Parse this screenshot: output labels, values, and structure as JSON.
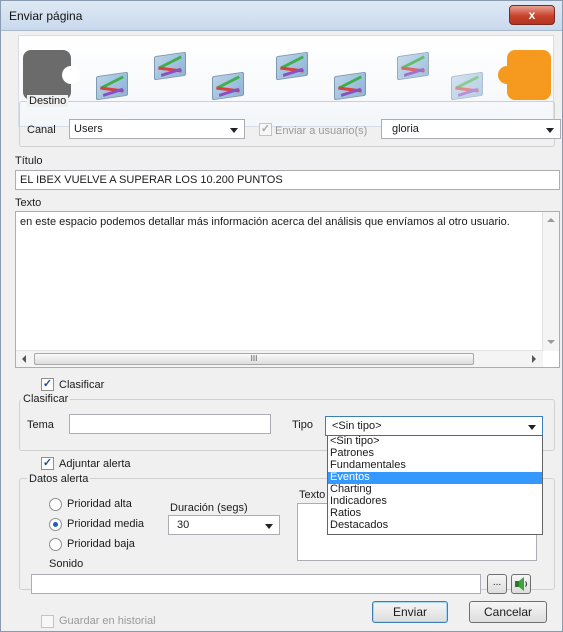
{
  "window": {
    "title": "Enviar página",
    "close_glyph": "x"
  },
  "banner": {
    "icons": [
      "puzzle-gray-icon",
      "chart-thumbnail-icon",
      "puzzle-orange-icon"
    ]
  },
  "destino": {
    "group_label": "Destino",
    "canal_label": "Canal",
    "canal_value": "Users",
    "send_to_user_label": "Enviar a usuario(s)",
    "send_to_user_checked": true,
    "user_value": "gloria"
  },
  "titulo": {
    "label": "Título",
    "value": "EL IBEX VUELVE A SUPERAR LOS 10.200 PUNTOS"
  },
  "texto": {
    "label": "Texto",
    "value": "en este espacio podemos detallar más información acerca del análisis que envíamos al otro usuario.",
    "hscroll_grip": "III"
  },
  "clasificar": {
    "checkbox_label": "Clasificar",
    "checked": true,
    "group_label": "Clasificar",
    "tema_label": "Tema",
    "tema_value": "",
    "tipo_label": "Tipo",
    "tipo_value": "<Sin tipo>",
    "tipo_options": [
      "<Sin tipo>",
      "Patrones",
      "Fundamentales",
      "Eventos",
      "Charting",
      "Indicadores",
      "Ratios",
      "Destacados"
    ],
    "tipo_highlighted": "Eventos"
  },
  "alerta": {
    "checkbox_label": "Adjuntar alerta",
    "checked": true,
    "group_label": "Datos alerta",
    "prioridad_alta": "Prioridad alta",
    "prioridad_media": "Prioridad media",
    "prioridad_baja": "Prioridad baja",
    "prioridad_selected": "Prioridad media",
    "duracion_label": "Duración (segs)",
    "duracion_value": "30",
    "texto_label": "Texto",
    "sonido_label": "Sonido",
    "sonido_value": "",
    "browse_label": "...",
    "speaker_icon": "speaker-icon"
  },
  "footer": {
    "guardar_label": "Guardar en historial",
    "guardar_checked": false,
    "enviar_label": "Enviar",
    "cancelar_label": "Cancelar"
  },
  "colors": {
    "accent": "#3399ff",
    "orange": "#f59a1e",
    "titlebar": "#c9d9ec"
  }
}
